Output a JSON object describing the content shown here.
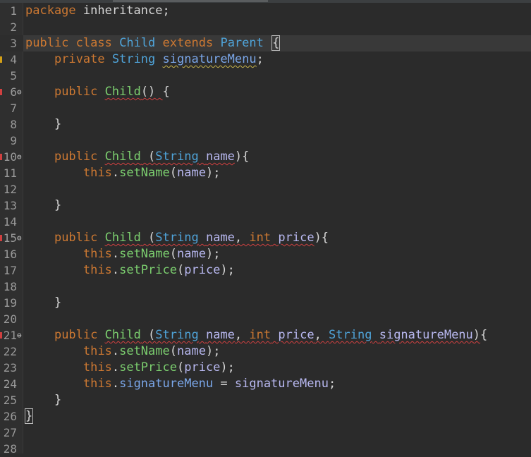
{
  "editor": {
    "language": "java",
    "colors": {
      "background": "#2b2b2b",
      "keyword": "#cc7832",
      "type": "#4fa3d8",
      "method": "#7ccf6f",
      "field": "#7aa6e8",
      "error": "#d04040"
    },
    "lines": [
      {
        "n": "1",
        "fold": "",
        "marker": "",
        "tokens": [
          {
            "t": "package",
            "c": "kw"
          },
          {
            "t": " inheritance;"
          }
        ]
      },
      {
        "n": "2",
        "fold": "",
        "marker": "",
        "tokens": []
      },
      {
        "n": "3",
        "fold": "",
        "marker": "",
        "hl": true,
        "tokens": [
          {
            "t": "public",
            "c": "kw"
          },
          {
            "t": " "
          },
          {
            "t": "class",
            "c": "kw"
          },
          {
            "t": " "
          },
          {
            "t": "Child",
            "c": "ty"
          },
          {
            "t": " "
          },
          {
            "t": "extends",
            "c": "kw"
          },
          {
            "t": " "
          },
          {
            "t": "Parent",
            "c": "ty"
          },
          {
            "t": " "
          },
          {
            "t": "{",
            "box": true
          }
        ]
      },
      {
        "n": "4",
        "fold": "",
        "marker": "#d4a017",
        "tokens": [
          {
            "t": "    "
          },
          {
            "t": "private",
            "c": "kw"
          },
          {
            "t": " "
          },
          {
            "t": "String",
            "c": "ty"
          },
          {
            "t": " "
          },
          {
            "t": "signatureMenu",
            "c": "fld",
            "u": "wy"
          },
          {
            "t": ";"
          }
        ]
      },
      {
        "n": "5",
        "fold": "",
        "marker": "",
        "tokens": []
      },
      {
        "n": "6",
        "fold": "⊖",
        "marker": "#d04040",
        "tokens": [
          {
            "t": "    "
          },
          {
            "t": "public",
            "c": "kw"
          },
          {
            "t": " "
          },
          {
            "t": "Child",
            "c": "fn",
            "u": "wv"
          },
          {
            "t": "() ",
            "u": "wv"
          },
          {
            "t": "{"
          }
        ]
      },
      {
        "n": "7",
        "fold": "",
        "marker": "",
        "tokens": []
      },
      {
        "n": "8",
        "fold": "",
        "marker": "",
        "tokens": [
          {
            "t": "    }"
          }
        ]
      },
      {
        "n": "9",
        "fold": "",
        "marker": "",
        "tokens": []
      },
      {
        "n": "10",
        "fold": "⊖",
        "marker": "#d04040",
        "tokens": [
          {
            "t": "    "
          },
          {
            "t": "public",
            "c": "kw"
          },
          {
            "t": " "
          },
          {
            "t": "Child",
            "c": "fn",
            "u": "wv"
          },
          {
            "t": " (",
            "u": "wv"
          },
          {
            "t": "String",
            "c": "ty",
            "u": "wv"
          },
          {
            "t": " ",
            "u": "wv"
          },
          {
            "t": "name",
            "c": "pr",
            "u": "wv"
          },
          {
            "t": "){"
          }
        ]
      },
      {
        "n": "11",
        "fold": "",
        "marker": "",
        "tokens": [
          {
            "t": "        "
          },
          {
            "t": "this",
            "c": "kw"
          },
          {
            "t": "."
          },
          {
            "t": "setName",
            "c": "fn"
          },
          {
            "t": "("
          },
          {
            "t": "name",
            "c": "pr"
          },
          {
            "t": ");"
          }
        ]
      },
      {
        "n": "12",
        "fold": "",
        "marker": "",
        "tokens": []
      },
      {
        "n": "13",
        "fold": "",
        "marker": "",
        "tokens": [
          {
            "t": "    }"
          }
        ]
      },
      {
        "n": "14",
        "fold": "",
        "marker": "",
        "tokens": []
      },
      {
        "n": "15",
        "fold": "⊖",
        "marker": "#d04040",
        "tokens": [
          {
            "t": "    "
          },
          {
            "t": "public",
            "c": "kw"
          },
          {
            "t": " "
          },
          {
            "t": "Child",
            "c": "fn",
            "u": "wv"
          },
          {
            "t": " (",
            "u": "wv"
          },
          {
            "t": "String",
            "c": "ty",
            "u": "wv"
          },
          {
            "t": " ",
            "u": "wv"
          },
          {
            "t": "name",
            "c": "pr",
            "u": "wv"
          },
          {
            "t": ", ",
            "u": "wv"
          },
          {
            "t": "int",
            "c": "kw",
            "u": "wv"
          },
          {
            "t": " ",
            "u": "wv"
          },
          {
            "t": "price",
            "c": "pr",
            "u": "wv"
          },
          {
            "t": "){"
          }
        ]
      },
      {
        "n": "16",
        "fold": "",
        "marker": "",
        "tokens": [
          {
            "t": "        "
          },
          {
            "t": "this",
            "c": "kw"
          },
          {
            "t": "."
          },
          {
            "t": "setName",
            "c": "fn"
          },
          {
            "t": "("
          },
          {
            "t": "name",
            "c": "pr"
          },
          {
            "t": ");"
          }
        ]
      },
      {
        "n": "17",
        "fold": "",
        "marker": "",
        "tokens": [
          {
            "t": "        "
          },
          {
            "t": "this",
            "c": "kw"
          },
          {
            "t": "."
          },
          {
            "t": "setPrice",
            "c": "fn"
          },
          {
            "t": "("
          },
          {
            "t": "price",
            "c": "pr"
          },
          {
            "t": ");"
          }
        ]
      },
      {
        "n": "18",
        "fold": "",
        "marker": "",
        "tokens": []
      },
      {
        "n": "19",
        "fold": "",
        "marker": "",
        "tokens": [
          {
            "t": "    }"
          }
        ]
      },
      {
        "n": "20",
        "fold": "",
        "marker": "",
        "tokens": []
      },
      {
        "n": "21",
        "fold": "⊖",
        "marker": "#d04040",
        "tokens": [
          {
            "t": "    "
          },
          {
            "t": "public",
            "c": "kw"
          },
          {
            "t": " "
          },
          {
            "t": "Child",
            "c": "fn",
            "u": "wv"
          },
          {
            "t": " (",
            "u": "wv"
          },
          {
            "t": "String",
            "c": "ty",
            "u": "wv"
          },
          {
            "t": " ",
            "u": "wv"
          },
          {
            "t": "name",
            "c": "pr",
            "u": "wv"
          },
          {
            "t": ", ",
            "u": "wv"
          },
          {
            "t": "int",
            "c": "kw",
            "u": "wv"
          },
          {
            "t": " ",
            "u": "wv"
          },
          {
            "t": "price",
            "c": "pr",
            "u": "wv"
          },
          {
            "t": ", ",
            "u": "wv"
          },
          {
            "t": "String",
            "c": "ty",
            "u": "wv"
          },
          {
            "t": " ",
            "u": "wv"
          },
          {
            "t": "signatureMenu",
            "c": "pr",
            "u": "wv"
          },
          {
            "t": ")",
            "u": "wv"
          },
          {
            "t": "{"
          }
        ]
      },
      {
        "n": "22",
        "fold": "",
        "marker": "",
        "tokens": [
          {
            "t": "        "
          },
          {
            "t": "this",
            "c": "kw"
          },
          {
            "t": "."
          },
          {
            "t": "setName",
            "c": "fn"
          },
          {
            "t": "("
          },
          {
            "t": "name",
            "c": "pr"
          },
          {
            "t": ");"
          }
        ]
      },
      {
        "n": "23",
        "fold": "",
        "marker": "",
        "tokens": [
          {
            "t": "        "
          },
          {
            "t": "this",
            "c": "kw"
          },
          {
            "t": "."
          },
          {
            "t": "setPrice",
            "c": "fn"
          },
          {
            "t": "("
          },
          {
            "t": "price",
            "c": "pr"
          },
          {
            "t": ");"
          }
        ]
      },
      {
        "n": "24",
        "fold": "",
        "marker": "",
        "tokens": [
          {
            "t": "        "
          },
          {
            "t": "this",
            "c": "kw"
          },
          {
            "t": "."
          },
          {
            "t": "signatureMenu",
            "c": "fld"
          },
          {
            "t": " = "
          },
          {
            "t": "signatureMenu",
            "c": "pr"
          },
          {
            "t": ";"
          }
        ]
      },
      {
        "n": "25",
        "fold": "",
        "marker": "",
        "tokens": [
          {
            "t": "    }"
          }
        ]
      },
      {
        "n": "26",
        "fold": "",
        "marker": "",
        "tokens": [
          {
            "t": "}",
            "box": true
          }
        ]
      },
      {
        "n": "27",
        "fold": "",
        "marker": "",
        "tokens": []
      },
      {
        "n": "28",
        "fold": "",
        "marker": "",
        "tokens": []
      }
    ]
  }
}
